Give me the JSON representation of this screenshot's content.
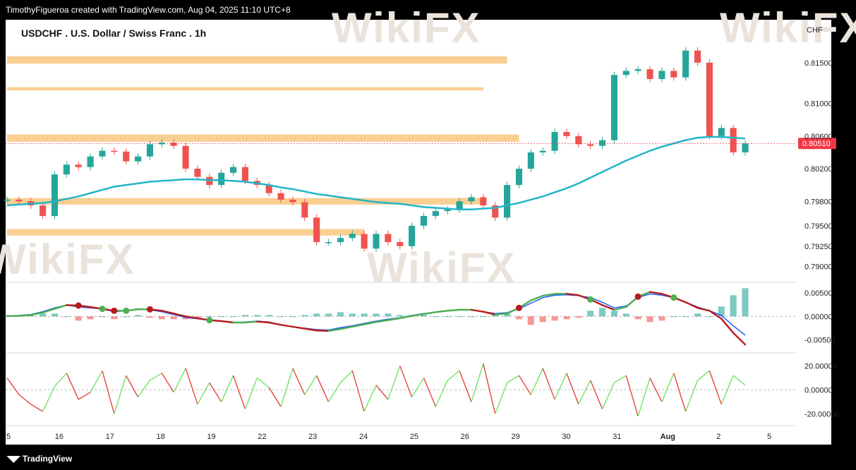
{
  "header": {
    "caption": "TimothyFigueroa created with TradingView.com, Aug 04, 2025 11:10 UTC+8"
  },
  "footer": {
    "brand": "TradingView",
    "brand_icon": "tradingview-logo-icon"
  },
  "watermarks": [
    "WikiFX",
    "WikiFX",
    "WikiFX",
    "WikiFX"
  ],
  "chart_data": {
    "type": "line",
    "title": "USDCHF . U.S. Dollar / Swiss Franc . 1h",
    "currency_label": "CHF",
    "x_ticks": [
      "5",
      "16",
      "17",
      "18",
      "19",
      "22",
      "23",
      "24",
      "25",
      "26",
      "29",
      "30",
      "31",
      "Aug",
      "2",
      "5"
    ],
    "price_pane": {
      "y_ticks": [
        "0.81500",
        "0.81000",
        "0.80600",
        "0.80200",
        "0.79800",
        "0.79500",
        "0.79250",
        "0.79000"
      ],
      "ylim": [
        0.7885,
        0.8175
      ],
      "last_price": "0.80510",
      "colors": {
        "up": "#26a69a",
        "down": "#ef5350",
        "ma": "#22b5c8",
        "zone": "#f9c77f",
        "last": "#f23645"
      },
      "zones": [
        {
          "x": [
            0,
            42
          ],
          "y": [
            0.8149,
            0.8158
          ]
        },
        {
          "x": [
            0,
            40
          ],
          "y": [
            0.8116,
            0.812
          ]
        },
        {
          "x": [
            0,
            43
          ],
          "y": [
            0.8053,
            0.8062
          ]
        },
        {
          "x": [
            0,
            40
          ],
          "y": [
            0.7976,
            0.7984
          ]
        },
        {
          "x": [
            0,
            30
          ],
          "y": [
            0.7938,
            0.7946
          ]
        }
      ],
      "close": [
        0.7982,
        0.798,
        0.7975,
        0.7962,
        0.8013,
        0.8025,
        0.8022,
        0.8035,
        0.8042,
        0.8041,
        0.8029,
        0.8035,
        0.805,
        0.8052,
        0.8048,
        0.802,
        0.801,
        0.8,
        0.8015,
        0.8022,
        0.8005,
        0.8,
        0.799,
        0.7982,
        0.7979,
        0.796,
        0.793,
        0.793,
        0.7935,
        0.794,
        0.7922,
        0.794,
        0.793,
        0.7925,
        0.795,
        0.7962,
        0.7968,
        0.797,
        0.798,
        0.7985,
        0.7975,
        0.796,
        0.8,
        0.802,
        0.804,
        0.8042,
        0.8065,
        0.806,
        0.805,
        0.8048,
        0.8055,
        0.8135,
        0.814,
        0.8142,
        0.813,
        0.814,
        0.8132,
        0.8165,
        0.815,
        0.806,
        0.807,
        0.804,
        0.8051
      ],
      "ma": [
        0.7975,
        0.7976,
        0.7977,
        0.7978,
        0.798,
        0.7983,
        0.7986,
        0.799,
        0.7994,
        0.7998,
        0.8,
        0.8002,
        0.8004,
        0.8005,
        0.8006,
        0.8007,
        0.8007,
        0.8006,
        0.8006,
        0.8005,
        0.8004,
        0.8002,
        0.8,
        0.7997,
        0.7995,
        0.7992,
        0.7989,
        0.7987,
        0.7985,
        0.7983,
        0.7981,
        0.7979,
        0.7978,
        0.7977,
        0.7975,
        0.7973,
        0.7972,
        0.7971,
        0.797,
        0.797,
        0.7971,
        0.7972,
        0.7975,
        0.7978,
        0.7982,
        0.7986,
        0.7991,
        0.7996,
        0.8002,
        0.8009,
        0.8016,
        0.8023,
        0.803,
        0.8036,
        0.8042,
        0.8047,
        0.8051,
        0.8055,
        0.8058,
        0.8059,
        0.8059,
        0.8058,
        0.8057
      ]
    },
    "macd_pane": {
      "y_ticks": [
        "0.00500",
        "0.00000",
        "-0.00500"
      ],
      "ylim": [
        -0.007,
        0.0065
      ],
      "colors": {
        "macd": "#2962ff",
        "signal_up": "#4caf50",
        "signal_down": "#b71c1c",
        "hist_up": "#26a69a",
        "hist_down": "#ef5350"
      },
      "macd": [
        0.0001,
        0.0002,
        0.0004,
        0.001,
        0.0018,
        0.0024,
        0.002,
        0.0018,
        0.0016,
        0.001,
        0.0012,
        0.0016,
        0.0014,
        0.001,
        0.0004,
        -0.0002,
        -0.0005,
        -0.0008,
        -0.001,
        -0.0013,
        -0.0012,
        -0.001,
        -0.0012,
        -0.0018,
        -0.0022,
        -0.0025,
        -0.0028,
        -0.0029,
        -0.0024,
        -0.002,
        -0.0015,
        -0.001,
        -0.0006,
        -0.0003,
        0.0002,
        0.0006,
        0.0009,
        0.0012,
        0.0014,
        0.0014,
        0.001,
        0.0006,
        0.0008,
        0.0016,
        0.0028,
        0.004,
        0.0045,
        0.0046,
        0.0044,
        0.004,
        0.003,
        0.0018,
        0.0022,
        0.004,
        0.0048,
        0.0045,
        0.004,
        0.003,
        0.002,
        0.0012,
        0.0002,
        -0.002,
        -0.004
      ],
      "signal": [
        0.0001,
        0.0001,
        0.0003,
        0.0008,
        0.0016,
        0.0024,
        0.0023,
        0.002,
        0.0016,
        0.0012,
        0.0012,
        0.0015,
        0.0015,
        0.0012,
        0.0006,
        0.0,
        -0.0004,
        -0.0008,
        -0.001,
        -0.0013,
        -0.0013,
        -0.0011,
        -0.0013,
        -0.0018,
        -0.0022,
        -0.0026,
        -0.003,
        -0.0031,
        -0.0027,
        -0.0022,
        -0.0017,
        -0.0012,
        -0.0008,
        -0.0004,
        0.0001,
        0.0005,
        0.0009,
        0.0012,
        0.0014,
        0.0014,
        0.001,
        0.0004,
        0.0006,
        0.0018,
        0.0034,
        0.0044,
        0.0048,
        0.0048,
        0.0045,
        0.0036,
        0.0024,
        0.0014,
        0.002,
        0.0042,
        0.0052,
        0.0048,
        0.004,
        0.003,
        0.0018,
        0.0012,
        -0.0005,
        -0.0035,
        -0.006
      ]
    },
    "oscillator_pane": {
      "y_ticks": [
        "20.00000",
        "0.00000",
        "-20.00000"
      ],
      "ylim": [
        -28,
        28
      ],
      "colors": {
        "pos": "#66e25a",
        "neg": "#e53935"
      },
      "values": [
        10,
        -4,
        -12,
        -18,
        3,
        14,
        -8,
        -2,
        16,
        -20,
        12,
        -6,
        8,
        14,
        -2,
        18,
        -12,
        6,
        -10,
        12,
        -16,
        10,
        2,
        -14,
        18,
        -4,
        12,
        -10,
        6,
        16,
        -18,
        4,
        -8,
        20,
        -6,
        10,
        -14,
        8,
        16,
        -10,
        22,
        -20,
        6,
        12,
        -4,
        18,
        -8,
        14,
        -12,
        8,
        -16,
        6,
        12,
        -22,
        10,
        -10,
        14,
        -18,
        8,
        16,
        -12,
        12,
        4
      ]
    }
  }
}
